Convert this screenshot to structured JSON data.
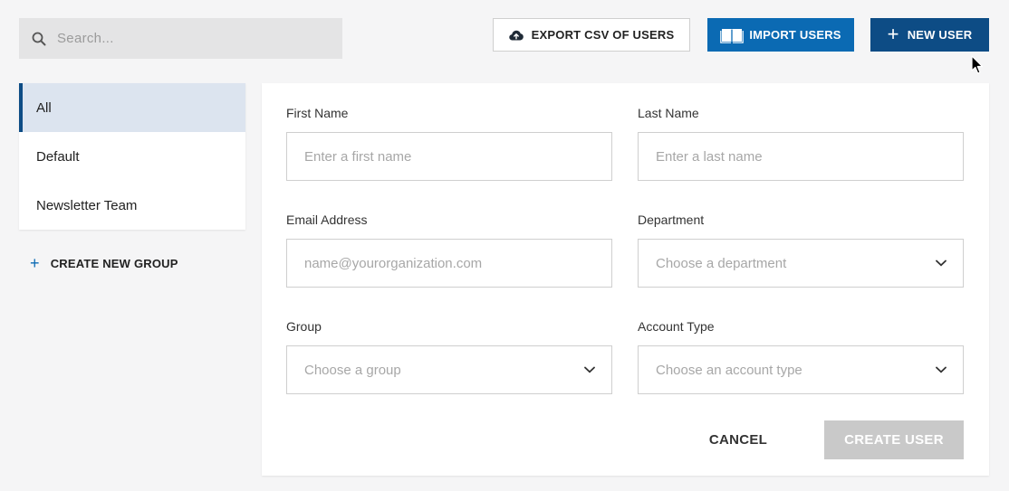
{
  "search": {
    "placeholder": "Search..."
  },
  "toolbar": {
    "export_label": "EXPORT CSV OF USERS",
    "import_label": "IMPORT USERS",
    "new_user_label": "NEW USER"
  },
  "groups": {
    "items": [
      {
        "label": "All",
        "active": true
      },
      {
        "label": "Default",
        "active": false
      },
      {
        "label": "Newsletter Team",
        "active": false
      }
    ],
    "create_label": "CREATE NEW GROUP"
  },
  "form": {
    "first_name": {
      "label": "First Name",
      "placeholder": "Enter a first name",
      "value": ""
    },
    "last_name": {
      "label": "Last Name",
      "placeholder": "Enter a last name",
      "value": ""
    },
    "email": {
      "label": "Email Address",
      "placeholder": "name@yourorganization.com",
      "value": ""
    },
    "department": {
      "label": "Department",
      "placeholder": "Choose a department"
    },
    "group": {
      "label": "Group",
      "placeholder": "Choose a group"
    },
    "account_type": {
      "label": "Account Type",
      "placeholder": "Choose an account type"
    },
    "cancel_label": "CANCEL",
    "create_label": "CREATE USER"
  },
  "colors": {
    "primary": "#0d4c85",
    "accent": "#0b6ab3",
    "disabled": "#c9c9c9",
    "active_bg": "#dce4ef"
  },
  "icons": {
    "search": "search-icon",
    "export": "cloud-upload-icon",
    "import": "book-icon",
    "chevron": "chevron-down-icon"
  }
}
